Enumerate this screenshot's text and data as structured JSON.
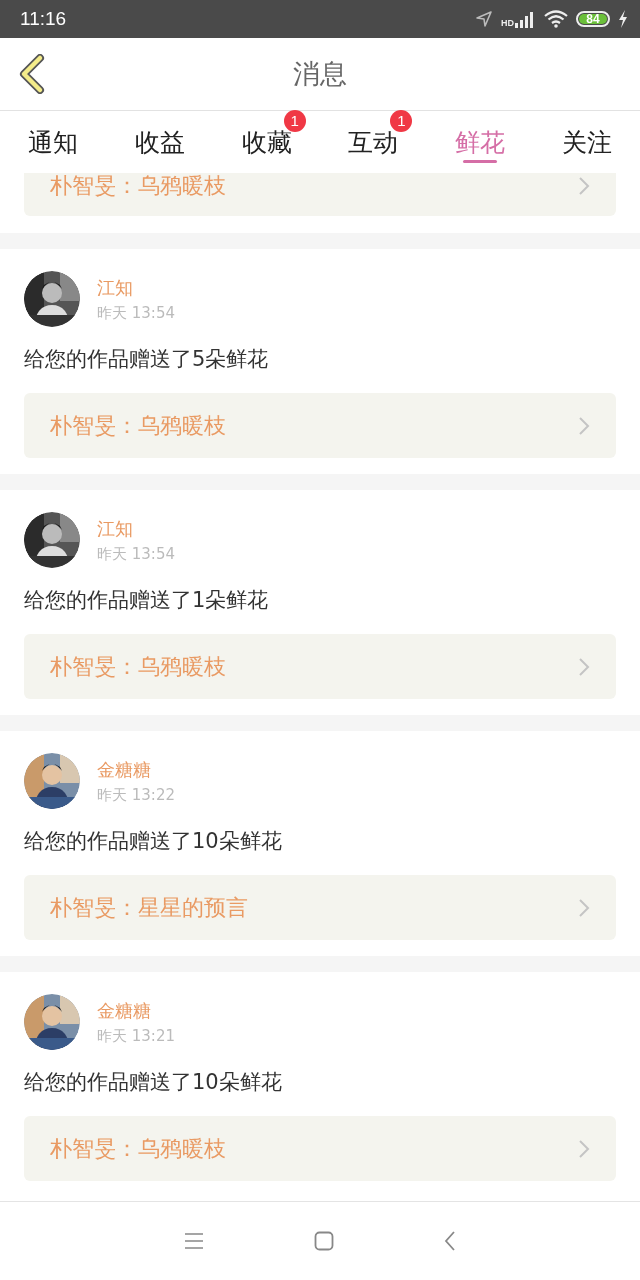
{
  "status_bar": {
    "time": "11:16",
    "network": "HD",
    "battery": "84"
  },
  "header": {
    "title": "消息"
  },
  "tabs": [
    {
      "label": "通知",
      "selected": false
    },
    {
      "label": "收益",
      "selected": false
    },
    {
      "label": "收藏",
      "selected": false,
      "badge": "1"
    },
    {
      "label": "互动",
      "selected": false,
      "badge": "1"
    },
    {
      "label": "鲜花",
      "selected": true
    },
    {
      "label": "关注",
      "selected": false
    }
  ],
  "messages": [
    {
      "kind": "partial",
      "work": "朴智旻：乌鸦暖枝"
    },
    {
      "kind": "full",
      "user": "江知",
      "time": "昨天 13:54",
      "text": "给您的作品赠送了5朵鲜花",
      "work": "朴智旻：乌鸦暖枝"
    },
    {
      "kind": "full",
      "user": "江知",
      "time": "昨天 13:54",
      "text": "给您的作品赠送了1朵鲜花",
      "work": "朴智旻：乌鸦暖枝"
    },
    {
      "kind": "full",
      "user": "金糖糖",
      "time": "昨天 13:22",
      "text": "给您的作品赠送了10朵鲜花",
      "work": "朴智旻：星星的预言"
    },
    {
      "kind": "full",
      "user": "金糖糖",
      "time": "昨天 13:21",
      "text": "给您的作品赠送了10朵鲜花",
      "work": "朴智旻：乌鸦暖枝"
    }
  ]
}
